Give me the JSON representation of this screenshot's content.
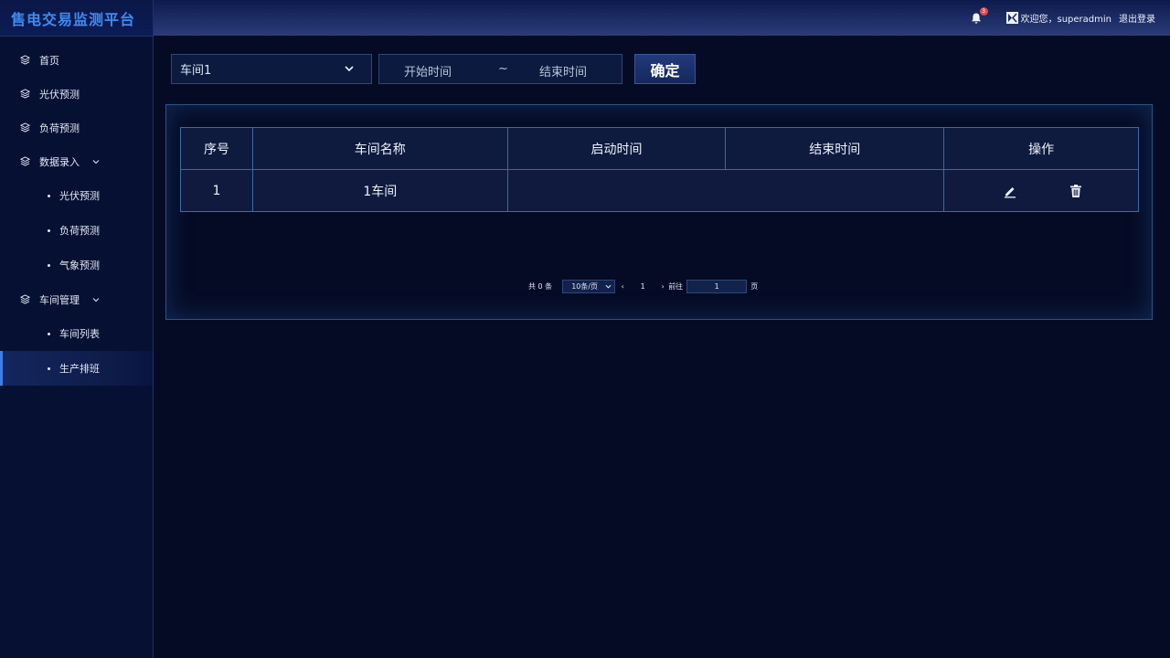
{
  "app": {
    "title": "售电交易监测平台"
  },
  "sidebar": {
    "items": [
      {
        "label": "首页"
      },
      {
        "label": "光伏预测"
      },
      {
        "label": "负荷预测"
      },
      {
        "label": "数据录入",
        "children": [
          {
            "label": "光伏预测"
          },
          {
            "label": "负荷预测"
          },
          {
            "label": "气象预测"
          }
        ]
      },
      {
        "label": "车间管理",
        "children": [
          {
            "label": "车间列表"
          },
          {
            "label": "生产排班",
            "active": true
          }
        ]
      }
    ]
  },
  "header": {
    "notification_count": "3",
    "welcome": "欢迎您，superadmin",
    "logout": "退出登录"
  },
  "filters": {
    "workshop_select": "车间1",
    "start_placeholder": "开始时间",
    "separator": "~",
    "end_placeholder": "结束时间",
    "confirm_label": "确定"
  },
  "table": {
    "columns": [
      "序号",
      "车间名称",
      "启动时间",
      "结束时间",
      "操作"
    ],
    "rows": [
      {
        "index": "1",
        "name": "1车间",
        "start": "",
        "end": ""
      }
    ]
  },
  "pagination": {
    "total": "共 0 条",
    "page_size": "10条/页",
    "prev": "‹",
    "current": "1",
    "next": "›",
    "goto_label": "前往",
    "goto_value": "1",
    "page_unit": "页"
  },
  "colors": {
    "background": "#050b25",
    "accent": "#3d7fe6",
    "border": "#3a6aa6",
    "badge": "#e5484d"
  }
}
